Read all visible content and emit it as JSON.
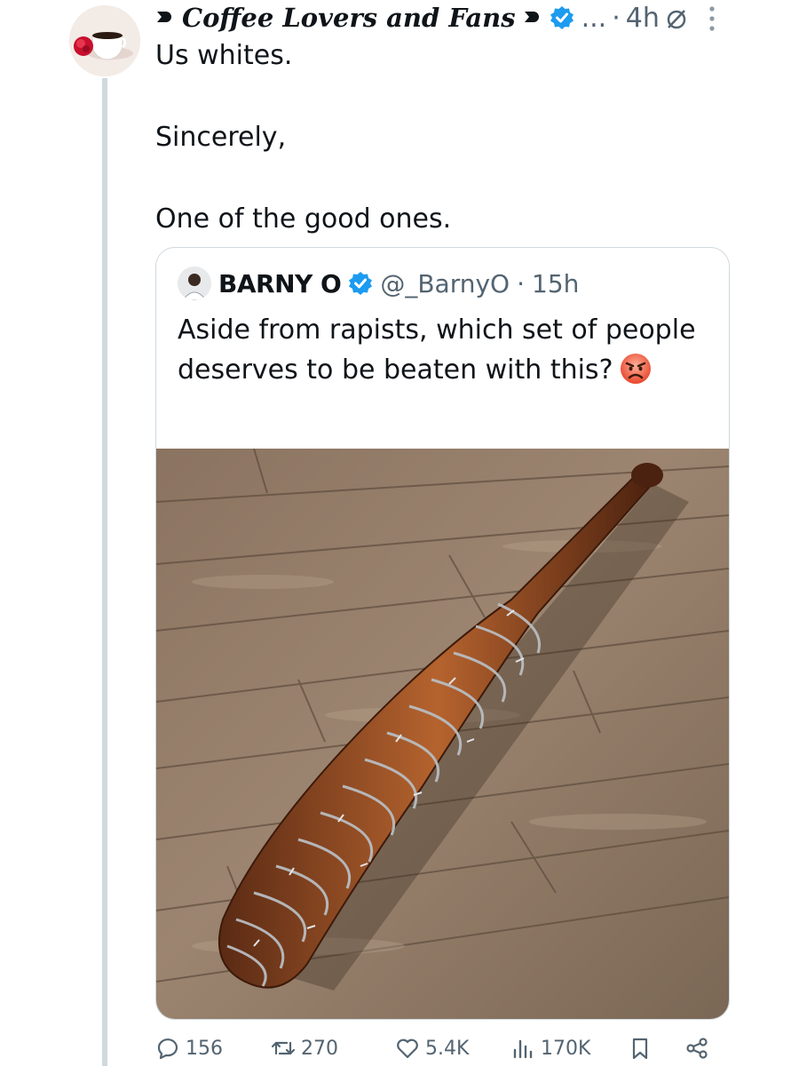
{
  "tweet": {
    "display_name": "Coffee Lovers and Fans",
    "meta_dots": "...",
    "meta_sep": "·",
    "time": "4h",
    "text": {
      "line1": "Us whites.",
      "line2": "Sincerely,",
      "line3": "One of the good ones."
    },
    "icons": {
      "leading": "heart-icon",
      "trailing": "heart-icon",
      "verified": "verified-badge-icon",
      "status": "circle-slash-icon",
      "more": "more-options-icon"
    }
  },
  "quote": {
    "name": "BARNY O",
    "handle": "@_BarnyO",
    "sep": "·",
    "time": "15h",
    "text": "Aside from rapists, which set of people deserves to be beaten with this?",
    "emoji": "angry-face-emoji",
    "media": "wooden-bat-wrapped-in-barbed-wire-on-floor"
  },
  "actions": {
    "replies": "156",
    "reposts": "270",
    "likes": "5.4K",
    "views": "170K"
  },
  "colors": {
    "text": "#0f1419",
    "muted": "#536471",
    "verified": "#1d9bf0",
    "border": "#cfd9de"
  }
}
